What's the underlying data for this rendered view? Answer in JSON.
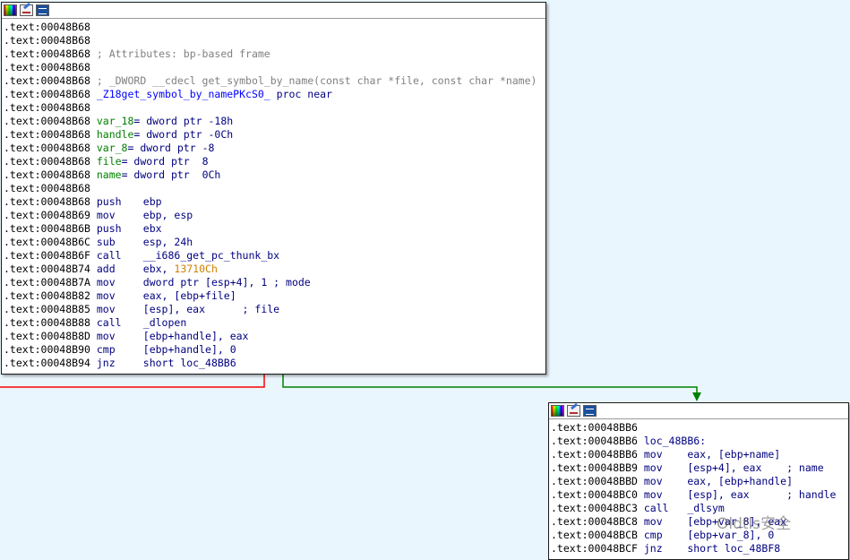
{
  "colors": {
    "background": "#eaf6fd",
    "edge_false": "#ff0000",
    "edge_true": "#008000",
    "operand_blue": "#000080",
    "comment_gray": "#808080",
    "var_green": "#008000",
    "immediate_orange": "#d08000"
  },
  "toolbar_icons": [
    "color-palette-icon",
    "edit-node-icon",
    "graph-overview-icon"
  ],
  "block1": {
    "lines": [
      {
        "addr": ".text:00048B68",
        "kind": "blank"
      },
      {
        "addr": ".text:00048B68",
        "kind": "blank"
      },
      {
        "addr": ".text:00048B68",
        "kind": "comment",
        "text": "; Attributes: bp-based frame"
      },
      {
        "addr": ".text:00048B68",
        "kind": "blank"
      },
      {
        "addr": ".text:00048B68",
        "kind": "comment",
        "text": "; _DWORD __cdecl get_symbol_by_name(const char *file, const char *name)"
      },
      {
        "addr": ".text:00048B68",
        "kind": "proc",
        "name": "_Z18get_symbol_by_namePKcS0_",
        "kw": "proc near"
      },
      {
        "addr": ".text:00048B68",
        "kind": "blank"
      },
      {
        "addr": ".text:00048B68",
        "kind": "var",
        "name": "var_18",
        "def": "= dword ptr -18h"
      },
      {
        "addr": ".text:00048B68",
        "kind": "var",
        "name": "handle",
        "def": "= dword ptr -0Ch"
      },
      {
        "addr": ".text:00048B68",
        "kind": "var",
        "name": "var_8",
        "def": "= dword ptr -8"
      },
      {
        "addr": ".text:00048B68",
        "kind": "var",
        "name": "file",
        "def": "= dword ptr  8"
      },
      {
        "addr": ".text:00048B68",
        "kind": "var",
        "name": "name",
        "def": "= dword ptr  0Ch"
      },
      {
        "addr": ".text:00048B68",
        "kind": "blank"
      },
      {
        "addr": ".text:00048B68",
        "kind": "insn",
        "mn": "push",
        "ops": "ebp"
      },
      {
        "addr": ".text:00048B69",
        "kind": "insn",
        "mn": "mov",
        "ops": "ebp, esp"
      },
      {
        "addr": ".text:00048B6B",
        "kind": "insn",
        "mn": "push",
        "ops": "ebx"
      },
      {
        "addr": ".text:00048B6C",
        "kind": "insn",
        "mn": "sub",
        "ops": "esp, 24h"
      },
      {
        "addr": ".text:00048B6F",
        "kind": "insn",
        "mn": "call",
        "ops": "__i686_get_pc_thunk_bx"
      },
      {
        "addr": ".text:00048B74",
        "kind": "insn",
        "mn": "add",
        "ops": "ebx, ",
        "imm": "13710Ch"
      },
      {
        "addr": ".text:00048B7A",
        "kind": "insn",
        "mn": "mov",
        "ops": "dword ptr [esp+4], 1 ; mode"
      },
      {
        "addr": ".text:00048B82",
        "kind": "insn",
        "mn": "mov",
        "ops": "eax, [ebp+file]"
      },
      {
        "addr": ".text:00048B85",
        "kind": "insn",
        "mn": "mov",
        "ops": "[esp], eax      ; file"
      },
      {
        "addr": ".text:00048B88",
        "kind": "insn",
        "mn": "call",
        "ops": "_dlopen"
      },
      {
        "addr": ".text:00048B8D",
        "kind": "insn",
        "mn": "mov",
        "ops": "[ebp+handle], eax"
      },
      {
        "addr": ".text:00048B90",
        "kind": "insn",
        "mn": "cmp",
        "ops": "[ebp+handle], 0"
      },
      {
        "addr": ".text:00048B94",
        "kind": "insn",
        "mn": "jnz",
        "ops": "short loc_48BB6"
      }
    ]
  },
  "block2": {
    "lines": [
      {
        "addr": ".text:00048BB6",
        "kind": "blank"
      },
      {
        "addr": ".text:00048BB6",
        "kind": "label",
        "text": "loc_48BB6:"
      },
      {
        "addr": ".text:00048BB6",
        "kind": "insn",
        "mn": "mov",
        "ops": "eax, [ebp+name]"
      },
      {
        "addr": ".text:00048BB9",
        "kind": "insn",
        "mn": "mov",
        "ops": "[esp+4], eax    ; name"
      },
      {
        "addr": ".text:00048BBD",
        "kind": "insn",
        "mn": "mov",
        "ops": "eax, [ebp+handle]"
      },
      {
        "addr": ".text:00048BC0",
        "kind": "insn",
        "mn": "mov",
        "ops": "[esp], eax      ; handle"
      },
      {
        "addr": ".text:00048BC3",
        "kind": "insn",
        "mn": "call",
        "ops": "_dlsym"
      },
      {
        "addr": ".text:00048BC8",
        "kind": "insn",
        "mn": "mov",
        "ops": "[ebp+var_8], eax"
      },
      {
        "addr": ".text:00048BCB",
        "kind": "insn",
        "mn": "cmp",
        "ops": "[ebp+var_8], 0"
      },
      {
        "addr": ".text:00048BCF",
        "kind": "insn",
        "mn": "jnz",
        "ops": "short loc_48BF8"
      }
    ]
  },
  "watermark": "Oldtls安全"
}
